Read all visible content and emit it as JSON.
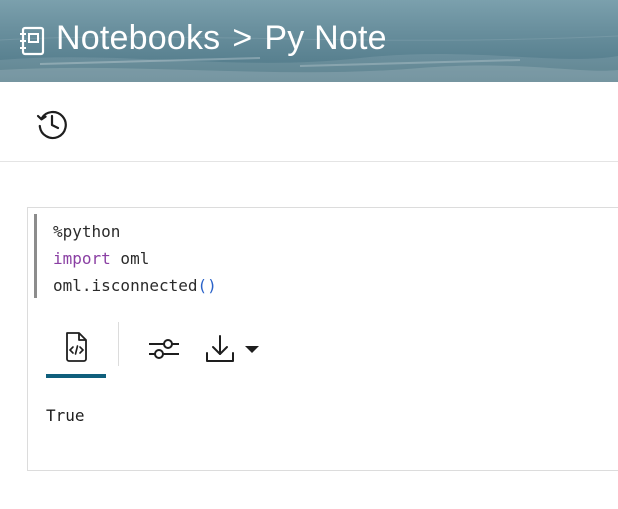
{
  "header": {
    "notebooks_label": "Notebooks",
    "separator": ">",
    "notebook_name": "Py Note"
  },
  "toolbar": {
    "history_icon": "history-clock-icon"
  },
  "paragraph": {
    "code_lines": {
      "line1": "%python",
      "line2_keyword": "import",
      "line2_rest": " oml",
      "line3_call": "oml.isconnected",
      "line3_parens": "()"
    },
    "result_tabs": {
      "active": "code-output",
      "icons": [
        "file-code-icon",
        "sliders-icon",
        "download-icon",
        "caret-down-icon"
      ]
    },
    "output": "True"
  },
  "colors": {
    "header": "#5f8796",
    "keyword": "#8a3fa3",
    "paren": "#2b63c9",
    "active_tab_underline": "#0f5f7c"
  }
}
